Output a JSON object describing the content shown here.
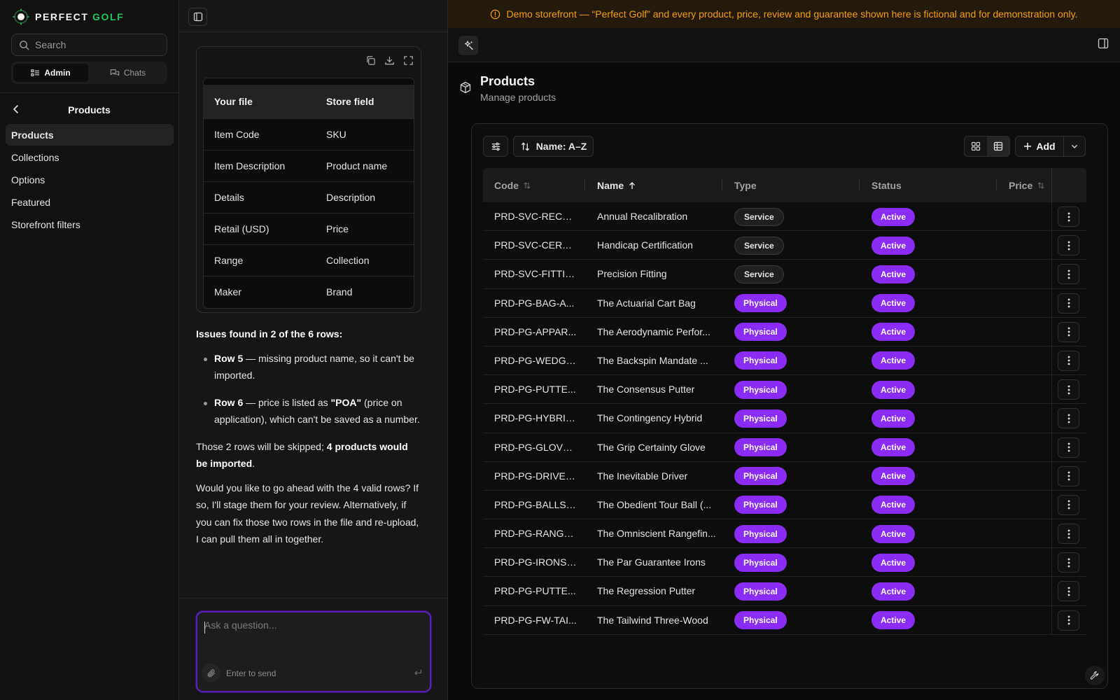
{
  "brand": {
    "name_part1": "PERFECT",
    "name_part2": "GOLF"
  },
  "sidebar": {
    "search_placeholder": "Search",
    "segments": [
      {
        "label": "Admin",
        "active": true
      },
      {
        "label": "Chats",
        "active": false
      }
    ],
    "section_title": "Products",
    "items": [
      {
        "label": "Products",
        "active": true
      },
      {
        "label": "Collections"
      },
      {
        "label": "Options"
      },
      {
        "label": "Featured"
      },
      {
        "label": "Storefront filters"
      }
    ]
  },
  "chat": {
    "mapping_table": {
      "headers": [
        "Your file",
        "Store field"
      ],
      "rows": [
        [
          "Item Code",
          "SKU"
        ],
        [
          "Item Description",
          "Product name"
        ],
        [
          "Details",
          "Description"
        ],
        [
          "Retail (USD)",
          "Price"
        ],
        [
          "Range",
          "Collection"
        ],
        [
          "Maker",
          "Brand"
        ]
      ]
    },
    "issues_heading": "Issues found in 2 of the 6 rows:",
    "issues": [
      {
        "row": "Row 5",
        "text": " — missing product name, so it can't be imported."
      },
      {
        "row": "Row 6",
        "text_before": " — price is listed as ",
        "emph": "\"POA\"",
        "text_after": " (price on application), which can't be saved as a number."
      }
    ],
    "summary_before": "Those 2 rows will be skipped; ",
    "summary_bold": "4 products would be imported",
    "summary_after": ".",
    "question": "Would you like to go ahead with the 4 valid rows? If so, I'll stage them for your review. Alternatively, if you can fix those two rows in the file and re-upload, I can pull them all in together.",
    "composer_placeholder": "Ask a question...",
    "composer_hint": "Enter to send"
  },
  "main": {
    "banner": "Demo storefront — “Perfect Golf” and every product, price, review and guarantee shown here is fictional and for demonstration only.",
    "title": "Products",
    "subtitle": "Manage products",
    "sort_label": "Name: A–Z",
    "add_label": "Add",
    "columns": {
      "code": "Code",
      "name": "Name",
      "type": "Type",
      "status": "Status",
      "price": "Price"
    },
    "rows": [
      {
        "code": "PRD-SVC-RECA...",
        "name": "Annual Recalibration",
        "type": "Service",
        "status": "Active"
      },
      {
        "code": "PRD-SVC-CERTI...",
        "name": "Handicap Certification",
        "type": "Service",
        "status": "Active"
      },
      {
        "code": "PRD-SVC-FITTING",
        "name": "Precision Fitting",
        "type": "Service",
        "status": "Active"
      },
      {
        "code": "PRD-PG-BAG-A...",
        "name": "The Actuarial Cart Bag",
        "type": "Physical",
        "status": "Active"
      },
      {
        "code": "PRD-PG-APPAR...",
        "name": "The Aerodynamic Perfor...",
        "type": "Physical",
        "status": "Active"
      },
      {
        "code": "PRD-PG-WEDGE...",
        "name": "The Backspin Mandate ...",
        "type": "Physical",
        "status": "Active"
      },
      {
        "code": "PRD-PG-PUTTE...",
        "name": "The Consensus Putter",
        "type": "Physical",
        "status": "Active"
      },
      {
        "code": "PRD-PG-HYBRID...",
        "name": "The Contingency Hybrid",
        "type": "Physical",
        "status": "Active"
      },
      {
        "code": "PRD-PG-GLOVE-...",
        "name": "The Grip Certainty Glove",
        "type": "Physical",
        "status": "Active"
      },
      {
        "code": "PRD-PG-DRIVER...",
        "name": "The Inevitable Driver",
        "type": "Physical",
        "status": "Active"
      },
      {
        "code": "PRD-PG-BALLS-...",
        "name": "The Obedient Tour Ball (...",
        "type": "Physical",
        "status": "Active"
      },
      {
        "code": "PRD-PG-RANGE...",
        "name": "The Omniscient Rangefin...",
        "type": "Physical",
        "status": "Active"
      },
      {
        "code": "PRD-PG-IRONS-...",
        "name": "The Par Guarantee Irons",
        "type": "Physical",
        "status": "Active"
      },
      {
        "code": "PRD-PG-PUTTE...",
        "name": "The Regression Putter",
        "type": "Physical",
        "status": "Active"
      },
      {
        "code": "PRD-PG-FW-TAI...",
        "name": "The Tailwind Three-Wood",
        "type": "Physical",
        "status": "Active"
      }
    ]
  },
  "colors": {
    "accent": "#8b2cf5",
    "brand_green": "#22c55e",
    "warning": "#f59e0b"
  }
}
